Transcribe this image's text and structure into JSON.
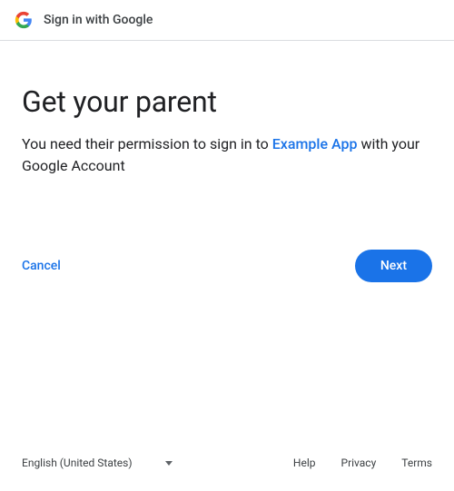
{
  "header": {
    "title": "Sign in with Google"
  },
  "main": {
    "heading": "Get your parent",
    "description_prefix": "You need their permission to sign in to ",
    "app_name": "Example App",
    "description_suffix": " with your Google Account"
  },
  "actions": {
    "cancel_label": "Cancel",
    "next_label": "Next"
  },
  "footer": {
    "language": "English (United States)",
    "links": {
      "help": "Help",
      "privacy": "Privacy",
      "terms": "Terms"
    }
  }
}
